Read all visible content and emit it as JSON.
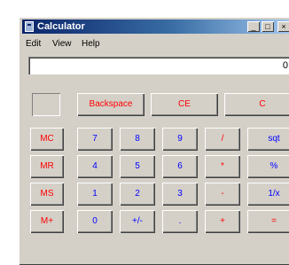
{
  "window": {
    "title": "Calculator",
    "minimize_glyph": "_",
    "maximize_glyph": "□",
    "close_glyph": "×"
  },
  "menu": [
    "Edit",
    "View",
    "Help"
  ],
  "display": {
    "value": "0."
  },
  "colors": {
    "title_start": "#0a246a",
    "title_end": "#a6caf0",
    "red": "#ff0000",
    "blue": "#0000ff",
    "face": "#d4d0c8"
  },
  "buttons": {
    "backspace": "Backspace",
    "ce": "CE",
    "c": "C",
    "mc": "MC",
    "mr": "MR",
    "ms": "MS",
    "mplus": "M+",
    "b7": "7",
    "b8": "8",
    "b9": "9",
    "div": "/",
    "sqrt": "sqt",
    "b4": "4",
    "b5": "5",
    "b6": "6",
    "mul": "*",
    "pct": "%",
    "b1": "1",
    "b2": "2",
    "b3": "3",
    "minus": "-",
    "recip": "1/x",
    "b0": "0",
    "sign": "+/-",
    "dot": ".",
    "plus": "+",
    "eq": "="
  }
}
